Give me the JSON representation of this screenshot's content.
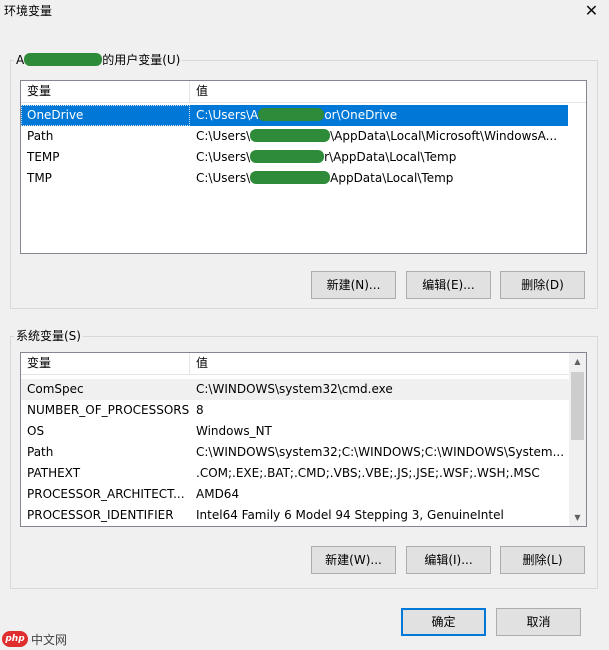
{
  "window": {
    "title": "环境变量",
    "close_glyph": "✕"
  },
  "user_vars": {
    "group_label_prefix": "A",
    "group_label_suffix": "的用户变量(U)",
    "columns": [
      "变量",
      "值"
    ],
    "rows": [
      {
        "name": "OneDrive",
        "value_a": "C:\\Users\\A",
        "value_b": "or\\OneDrive"
      },
      {
        "name": "Path",
        "value_a": "C:\\Users\\",
        "value_b": "\\AppData\\Local\\Microsoft\\WindowsA..."
      },
      {
        "name": "TEMP",
        "value_a": "C:\\Users\\",
        "value_b": "r\\AppData\\Local\\Temp"
      },
      {
        "name": "TMP",
        "value_a": "C:\\Users\\",
        "value_b": "AppData\\Local\\Temp"
      }
    ],
    "buttons": {
      "new": "新建(N)...",
      "edit": "编辑(E)...",
      "delete": "删除(D)"
    }
  },
  "system_vars": {
    "group_label": "系统变量(S)",
    "columns": [
      "变量",
      "值"
    ],
    "rows": [
      {
        "name": "ComSpec",
        "value": "C:\\WINDOWS\\system32\\cmd.exe"
      },
      {
        "name": "NUMBER_OF_PROCESSORS",
        "value": "8"
      },
      {
        "name": "OS",
        "value": "Windows_NT"
      },
      {
        "name": "Path",
        "value": "C:\\WINDOWS\\system32;C:\\WINDOWS;C:\\WINDOWS\\System..."
      },
      {
        "name": "PATHEXT",
        "value": ".COM;.EXE;.BAT;.CMD;.VBS;.VBE;.JS;.JSE;.WSF;.WSH;.MSC"
      },
      {
        "name": "PROCESSOR_ARCHITECT...",
        "value": "AMD64"
      },
      {
        "name": "PROCESSOR_IDENTIFIER",
        "value": "Intel64 Family 6 Model 94 Stepping 3, GenuineIntel"
      }
    ],
    "buttons": {
      "new": "新建(W)...",
      "edit": "编辑(I)...",
      "delete": "删除(L)"
    },
    "scroll_up": "▲",
    "scroll_down": "▼"
  },
  "dialog_buttons": {
    "ok": "确定",
    "cancel": "取消"
  },
  "watermark": {
    "badge": "php",
    "text": "中文网"
  },
  "colors": {
    "selection": "#0078d7",
    "redaction": "#2e8b3a",
    "accent": "#0078d7"
  }
}
